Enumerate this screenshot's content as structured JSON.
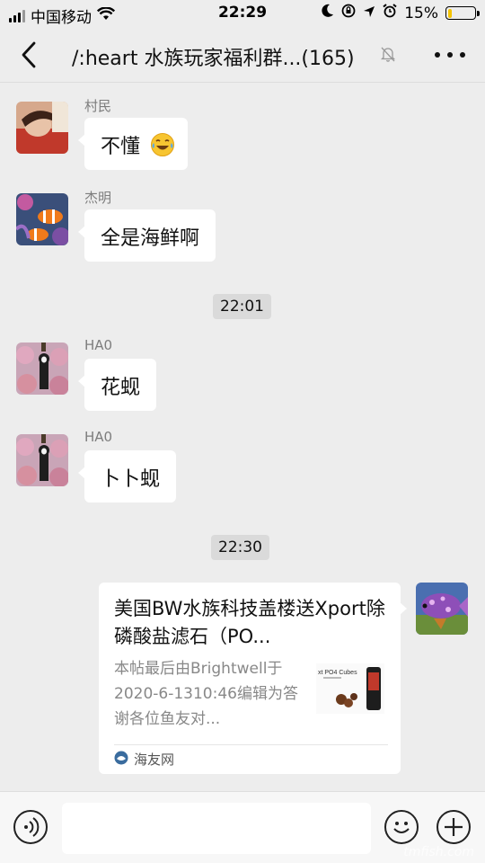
{
  "status_bar": {
    "carrier": "中国移动",
    "time": "22:29",
    "battery": "15%",
    "battery_level": 0.15
  },
  "nav": {
    "title": "/:heart 水族玩家福利群...(165)"
  },
  "messages": [
    {
      "sender": "村民",
      "text": "不懂"
    },
    {
      "sender": "杰明",
      "text": "全是海鲜啊"
    },
    {
      "sender": "HA0",
      "text": "花蚬"
    },
    {
      "sender": "HA0",
      "text": "卜卜蚬"
    }
  ],
  "timestamps": [
    "22:01",
    "22:30"
  ],
  "link_card": {
    "title": "美国BW水族科技盖楼送Xport除磷酸盐滤石（PO...",
    "description": "本帖最后由Brightwell于2020-6-1310:46编辑为答谢各位鱼友对...",
    "source": "海友网",
    "thumb_text": "xt PO4 Cubes"
  },
  "input": {
    "placeholder": ""
  },
  "watermark": "tmfish.com",
  "colors": {
    "background": "#ededed",
    "bubble": "#ffffff",
    "battery": "#f5c400"
  }
}
